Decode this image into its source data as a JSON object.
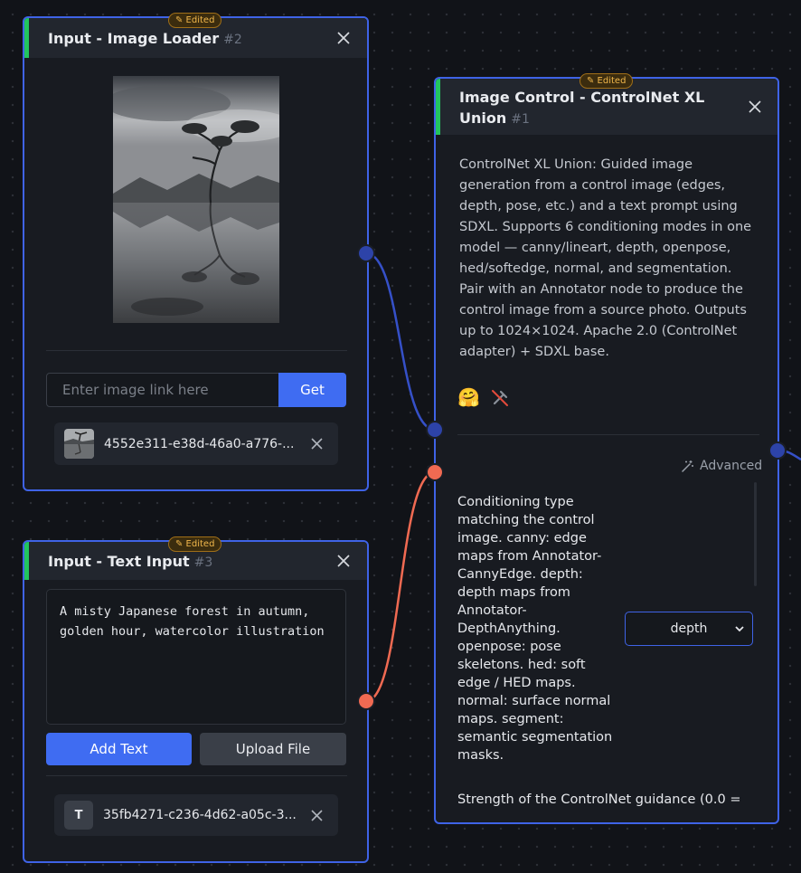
{
  "image_loader": {
    "title": "Input - Image Loader",
    "node_id": "#2",
    "badge": "✎ Edited",
    "url_placeholder": "Enter image link here",
    "get_label": "Get",
    "file_name": "4552e311-e38d-46a0-a776-..."
  },
  "text_input": {
    "title": "Input - Text Input",
    "node_id": "#3",
    "badge": "✎ Edited",
    "prompt": "A misty Japanese forest in autumn, golden hour, watercolor illustration",
    "add_text_label": "Add Text",
    "upload_file_label": "Upload File",
    "chip_letter": "T",
    "file_name": "35fb4271-c236-4d62-a05c-3..."
  },
  "controlnet": {
    "title_line1": "Image Control - ControlNet XL",
    "title_line2": "Union",
    "node_id": "#1",
    "badge": "✎ Edited",
    "description": "ControlNet XL Union: Guided image generation from a control image (edges, depth, pose, etc.) and a text prompt using SDXL. Supports 6 conditioning modes in one model — canny/lineart, depth, openpose, hed/softedge, normal, and segmentation. Pair with an Annotator node to produce the control image from a source photo. Outputs up to 1024×1024. Apache 2.0 (ControlNet adapter) + SDXL base.",
    "hf_icon": "🤗",
    "advanced_label": "Advanced",
    "conditioning_help": "Conditioning type matching the control image. canny: edge maps from Annotator-CannyEdge. depth: depth maps from Annotator-DepthAnything. openpose: pose skeletons. hed: soft edge / HED maps. normal: surface normal maps. segment: semantic segmentation masks.",
    "conditioning_value": "depth",
    "strength_help": "Strength of the ControlNet guidance (0.0 ="
  },
  "colors": {
    "node_border": "#3f63e6",
    "header_accent": "#22c55e",
    "primary_button": "#3f6cf2",
    "image_port_edge": "#3550c8",
    "text_port_edge": "#f06a52",
    "badge_text": "#f2b84c"
  }
}
